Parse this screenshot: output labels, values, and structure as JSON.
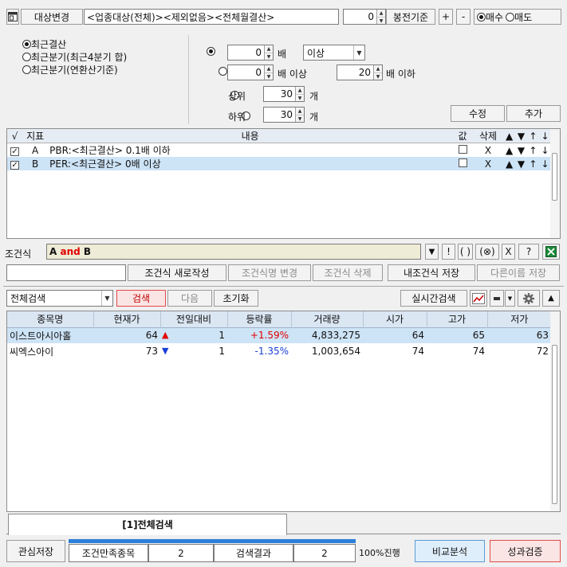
{
  "topbar": {
    "target_button": "대상변경",
    "target_desc": "<업종대상(전체)><제외없음><전체월결산>",
    "bong_value": "0",
    "bong_label": "봉전기준",
    "plus": "+",
    "minus": "-",
    "buy": "매수",
    "sell": "매도",
    "selected": "buy"
  },
  "period_options": [
    {
      "label": "최근결산",
      "selected": true
    },
    {
      "label": "최근분기(최근4분기 합)",
      "selected": false
    },
    {
      "label": "최근분기(연환산기준)",
      "selected": false
    }
  ],
  "conditions": {
    "row1": {
      "value": "0",
      "unit": "배",
      "dropdown": "이상"
    },
    "row2": {
      "value": "0",
      "unit": "배 이상",
      "value2": "20",
      "unit2": "배 이하"
    },
    "row3": {
      "label": "상위",
      "value": "30",
      "unit": "개"
    },
    "row4": {
      "label": "하위",
      "value": "30",
      "unit": "개"
    },
    "edit_button": "수정",
    "add_button": "추가"
  },
  "cond_table": {
    "headers": {
      "check": "√",
      "index": "지표",
      "content": "내용",
      "value": "값",
      "delete": "삭제",
      "up": "▲",
      "down": "▼",
      "top": "↑",
      "bottom": "↓"
    },
    "rows": [
      {
        "index": "A",
        "content": "PBR:<최근결산> 0.1배 이하",
        "delete": "X",
        "up": "▲",
        "down": "▼",
        "top": "↑",
        "bottom": "↓"
      },
      {
        "index": "B",
        "content": "PER:<최근결산> 0배 이상",
        "delete": "X",
        "up": "▲",
        "down": "▼",
        "top": "↑",
        "bottom": "↓"
      }
    ]
  },
  "formula": {
    "label": "조건식",
    "part1": "A",
    "op": "and",
    "part2": "B",
    "down_btn": "▼",
    "excl_btn": "!",
    "paren_btn": "( )",
    "x_circle_btn": "(⊗)",
    "x_btn": "X",
    "q_btn": "?"
  },
  "actions": {
    "new_formula": "조건식 새로작성",
    "rename_formula": "조건식명 변경",
    "delete_formula": "조건식 삭제",
    "save_mine": "내조건식 저장",
    "save_as": "다른이름 저장"
  },
  "search": {
    "scope": "전체검색",
    "search_btn": "검색",
    "next_btn": "다음",
    "reset_btn": "초기화",
    "realtime_btn": "실시간검색"
  },
  "results": {
    "headers": [
      "종목명",
      "현재가",
      "전일대비",
      "등락률",
      "거래량",
      "시가",
      "고가",
      "저가"
    ],
    "rows": [
      {
        "name": "이스트아시아홀",
        "price": "64",
        "dir": "up",
        "change": "1",
        "rate": "+1.59%",
        "volume": "4,833,275",
        "open": "64",
        "high": "65",
        "low": "63"
      },
      {
        "name": "씨엑스아이",
        "price": "73",
        "dir": "down",
        "change": "1",
        "rate": "-1.35%",
        "volume": "1,003,654",
        "open": "74",
        "high": "74",
        "low": "72"
      }
    ]
  },
  "tabs": {
    "active": "[1]전체검색"
  },
  "bottom": {
    "watch_save": "관심저장",
    "satisfied_label": "조건만족종목",
    "satisfied_count": "2",
    "result_label": "검색결과",
    "result_count": "2",
    "progress_text": "100%진행",
    "progress": 1.0,
    "compare": "비교분석",
    "verify": "성과검증"
  },
  "colors": {
    "accent_red": "#e00000",
    "accent_blue": "#1a3fd6",
    "selected_row": "#cde3f6",
    "header_bg": "#dbe6f3",
    "progress": "#2d7fd9"
  }
}
